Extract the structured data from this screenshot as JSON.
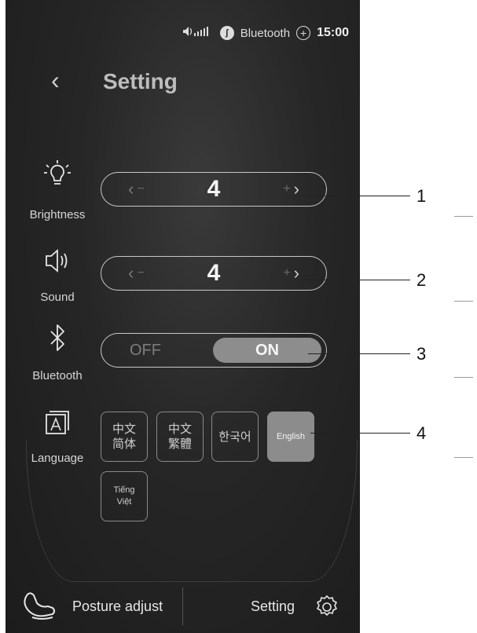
{
  "status": {
    "bluetooth_label": "Bluetooth",
    "bluetooth_badge": "ʃ",
    "plus": "+",
    "time": "15:00"
  },
  "header": {
    "back": "‹",
    "title": "Setting"
  },
  "brightness": {
    "label": "Brightness",
    "value": "4",
    "dec": "‹",
    "dec_minus": "−",
    "inc_plus": "+",
    "inc": "›"
  },
  "sound": {
    "label": "Sound",
    "value": "4",
    "dec": "‹",
    "dec_minus": "−",
    "inc_plus": "+",
    "inc": "›"
  },
  "bluetooth": {
    "label": "Bluetooth",
    "off": "OFF",
    "on": "ON",
    "state": "ON"
  },
  "language": {
    "label": "Language",
    "options": [
      {
        "line1": "中文",
        "line2": "简体"
      },
      {
        "line1": "中文",
        "line2": "繁體"
      },
      {
        "line1": "한국어",
        "line2": ""
      },
      {
        "line1": "English",
        "line2": ""
      },
      {
        "line1": "Tiếng",
        "line2": "Việt"
      }
    ],
    "selected": "English"
  },
  "bottom_nav": {
    "posture": "Posture adjust",
    "setting": "Setting"
  },
  "callouts": [
    "1",
    "2",
    "3",
    "4"
  ],
  "icons": [
    "signal-volume-icon",
    "bluetooth-badge-icon",
    "plus-circle-icon",
    "lightbulb-icon",
    "speaker-icon",
    "bluetooth-icon",
    "language-icon",
    "chair-icon",
    "gear-icon"
  ]
}
